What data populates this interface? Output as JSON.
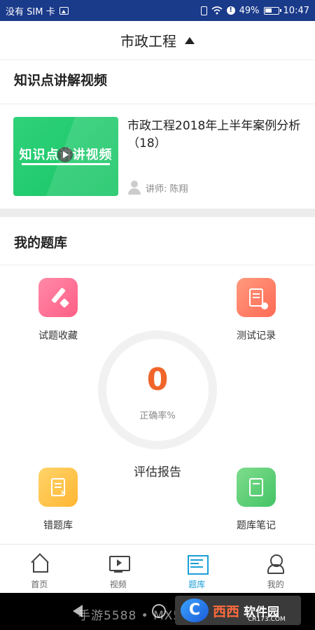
{
  "status_bar": {
    "carrier": "没有 SIM 卡",
    "battery": "49%",
    "time": "10:47"
  },
  "header": {
    "title": "市政工程"
  },
  "video_section": {
    "title": "知识点讲解视频",
    "thumbnail_text": "知识点讲讲视频",
    "video_title": "市政工程2018年上半年案例分析（18）",
    "teacher": "讲师: 陈翔"
  },
  "bank_section": {
    "title": "我的题库",
    "tiles": [
      {
        "label": "试题收藏",
        "icon": "pencil-star-icon",
        "color": "#ff6b8f"
      },
      {
        "label": "测试记录",
        "icon": "document-clock-icon",
        "color": "#ff7a60"
      },
      {
        "label": "错题库",
        "icon": "document-x-icon",
        "color": "#ffc244"
      },
      {
        "label": "题库笔记",
        "icon": "notebook-icon",
        "color": "#56cc72"
      }
    ],
    "accuracy": {
      "value": "0",
      "label": "正确率%"
    },
    "report_label": "评估报告"
  },
  "bottom_nav": {
    "items": [
      {
        "label": "首页",
        "icon": "home-icon",
        "active": false
      },
      {
        "label": "视频",
        "icon": "tv-icon",
        "active": false
      },
      {
        "label": "题库",
        "icon": "question-bank-icon",
        "active": true
      },
      {
        "label": "我的",
        "icon": "profile-icon",
        "active": false
      }
    ]
  },
  "watermark": {
    "text": "手游5588 • MX5588.COM",
    "logo_mark": "C",
    "logo_name": "西西",
    "logo_name2": "软件园",
    "logo_sub": "CR173.COM"
  },
  "colors": {
    "status_bar": "#1a3a8a",
    "accent": "#1a9fd6",
    "score": "#f0652a"
  }
}
